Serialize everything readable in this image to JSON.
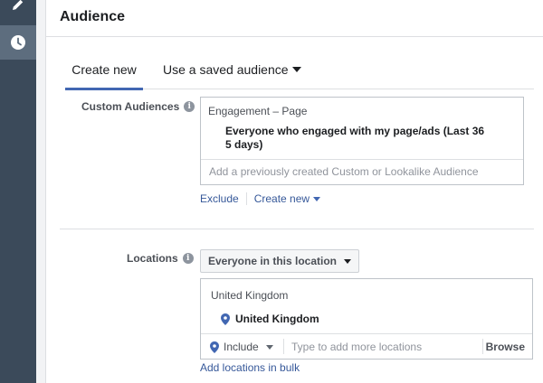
{
  "header": {
    "title": "Audience"
  },
  "sidebar": {
    "icons": [
      "pencil-icon",
      "clock-icon"
    ]
  },
  "tabs": [
    {
      "label": "Create new",
      "active": true
    },
    {
      "label": "Use a saved audience",
      "active": false
    }
  ],
  "custom_audiences": {
    "label": "Custom Audiences",
    "category": "Engagement – Page",
    "selected_item": "Everyone who engaged with my page/ads (Last 36 5 days)",
    "placeholder": "Add a previously created Custom or Lookalike Audience",
    "exclude_label": "Exclude",
    "create_new_label": "Create new"
  },
  "locations": {
    "label": "Locations",
    "dropdown_value": "Everyone in this location",
    "category": "United Kingdom",
    "selected_item": "United Kingdom",
    "include_value": "Include",
    "placeholder": "Type to add more locations",
    "browse_label": "Browse",
    "bulk_link": "Add locations in bulk"
  },
  "colors": {
    "sidebar": "#3b4a5a",
    "accent": "#4267b2",
    "link": "#365899"
  }
}
